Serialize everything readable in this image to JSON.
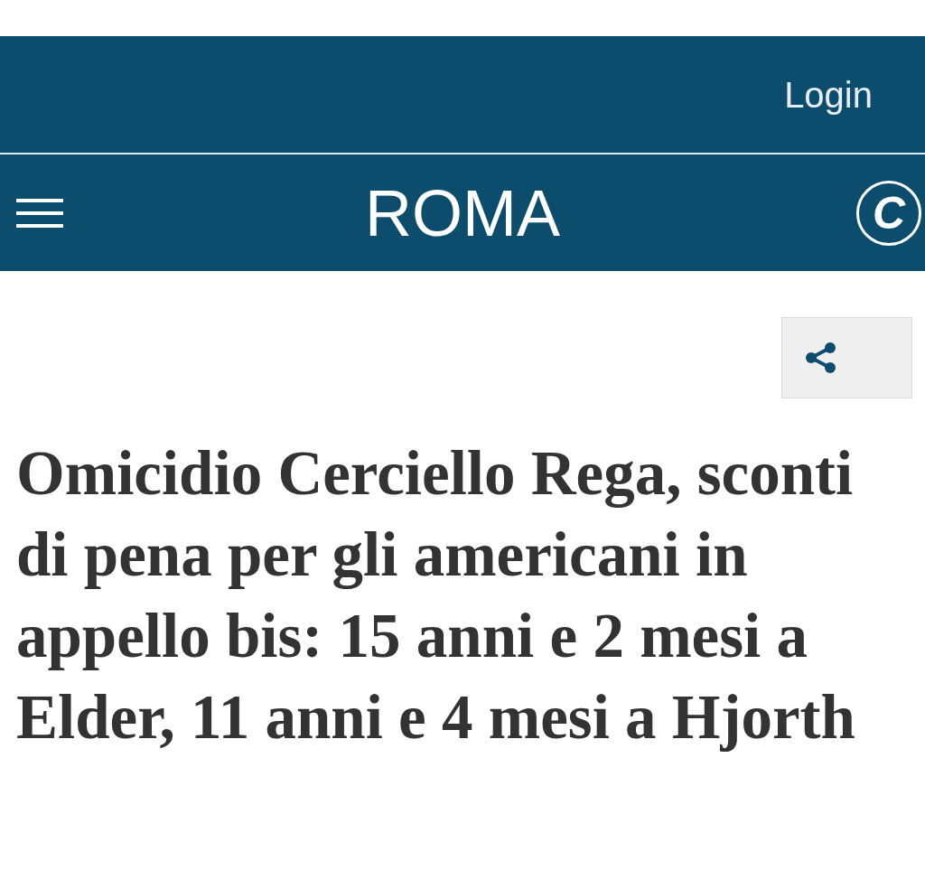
{
  "top_bar": {
    "login": "Login"
  },
  "nav_bar": {
    "section": "ROMA",
    "logo": "C"
  },
  "article": {
    "headline": "Omicidio Cerciello Rega, sconti di pena per gli americani in appello bis: 15 anni e 2 mesi a Elder, 11 anni e 4 mesi a Hjorth"
  }
}
